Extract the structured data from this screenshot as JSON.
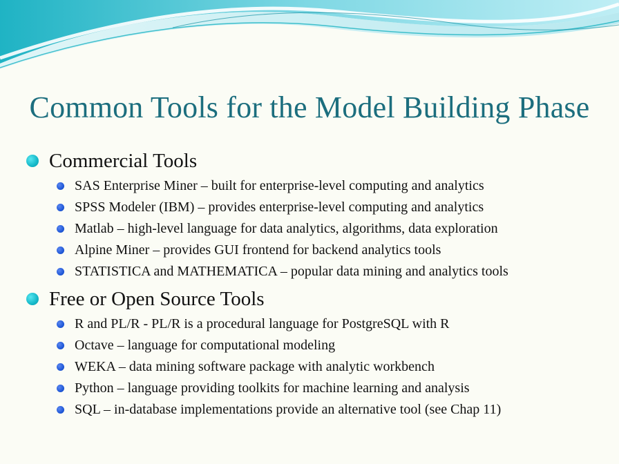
{
  "slide": {
    "title": "Common Tools for the Model Building Phase",
    "sections": [
      {
        "heading": "Commercial Tools",
        "items": [
          "SAS Enterprise Miner – built for enterprise-level computing and analytics",
          "SPSS Modeler (IBM) – provides enterprise-level computing and analytics",
          "Matlab – high-level language for data analytics, algorithms, data exploration",
          "Alpine Miner – provides GUI frontend for backend analytics tools",
          "STATISTICA and MATHEMATICA – popular data mining and analytics tools"
        ]
      },
      {
        "heading": "Free or Open Source Tools",
        "items": [
          "R and PL/R - PL/R is a procedural language for PostgreSQL with R",
          "Octave – language for computational modeling",
          "WEKA – data mining software package with analytic workbench",
          "Python – language providing toolkits for machine learning and analysis",
          "SQL – in-database implementations provide an alternative tool (see Chap 11)"
        ]
      }
    ],
    "colors": {
      "title": "#1c6e7e",
      "level1_bullet": "#14b8c8",
      "level2_bullet": "#1d56d6",
      "wave_dark": "#23b7c6",
      "wave_light": "#bdecf2"
    }
  }
}
